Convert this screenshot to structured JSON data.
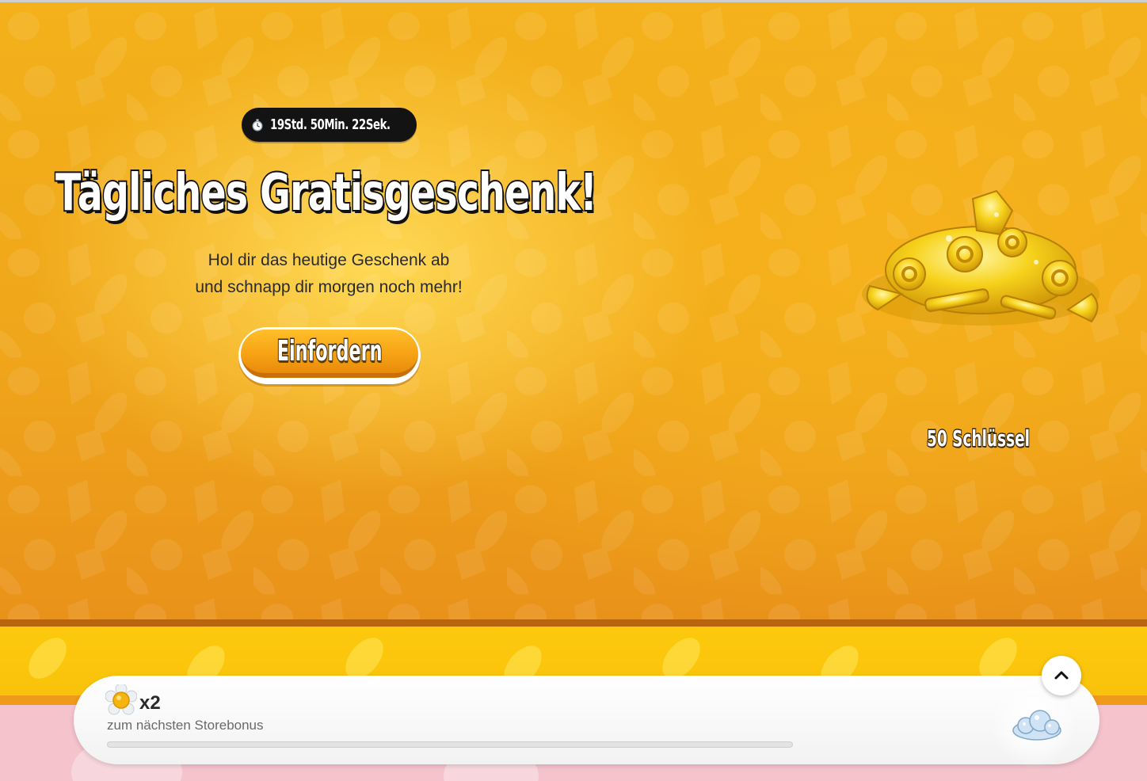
{
  "timer": {
    "text": "19Std. 50Min. 22Sek.",
    "icon": "stopwatch-icon"
  },
  "offer": {
    "title": "Tägliches Gratisgeschenk!",
    "subtitle_line1": "Hol dir das heutige Geschenk ab",
    "subtitle_line2": "und schnapp dir morgen noch mehr!",
    "claim_label": "Einfordern",
    "reward_label": "50 Schlüssel",
    "reward_icon": "gold-keys-icon"
  },
  "store_bonus": {
    "multiplier": "x2",
    "text": "zum nächsten Storebonus",
    "progress": 0,
    "icon": "flower-icon",
    "reward_icon": "diamond-cloud-icon",
    "collapse_icon": "chevron-up-icon"
  },
  "colors": {
    "banner": "#f3b11b",
    "button": "#f7a315",
    "strip": "#fdc90d",
    "pink": "#f4c3cc"
  }
}
